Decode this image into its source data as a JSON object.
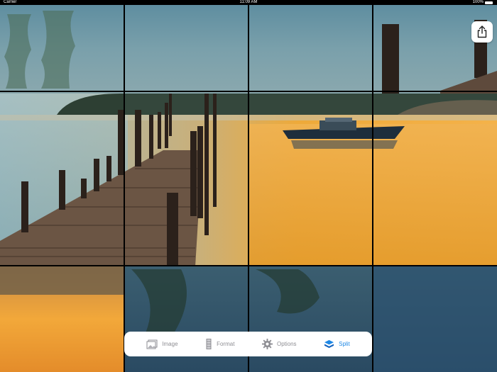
{
  "status_bar": {
    "carrier": "Carrier",
    "time": "11:09 AM",
    "battery": "100%"
  },
  "toolbar": {
    "items": [
      {
        "label": "Image",
        "icon": "image-icon",
        "active": false
      },
      {
        "label": "Format",
        "icon": "format-icon",
        "active": false
      },
      {
        "label": "Options",
        "icon": "gear-icon",
        "active": false
      },
      {
        "label": "Split",
        "icon": "layers-icon",
        "active": true
      }
    ]
  },
  "grid": {
    "columns": 4,
    "rows": 4
  },
  "colors": {
    "accent": "#1e88e5",
    "inactive": "#8e8e93"
  }
}
